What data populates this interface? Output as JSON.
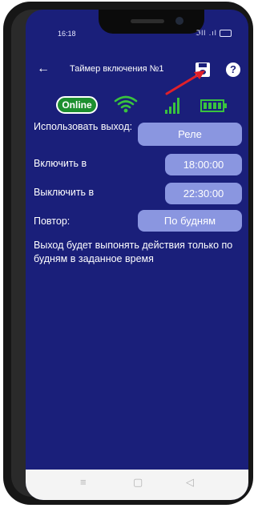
{
  "status_bar": {
    "time": "16:18",
    "icons": "ℑll .ıl"
  },
  "header": {
    "back_icon": "arrow-left-icon",
    "title": "Таймер включения №1",
    "save_icon": "save-icon",
    "help_icon": "help-icon",
    "help_glyph": "?"
  },
  "indicators": {
    "online_label": "Online",
    "online_color": "#1d8f2f",
    "wifi_color": "#39c33e",
    "signal_color": "#39c33e",
    "battery_color": "#39c33e"
  },
  "form": {
    "output_label": "Использовать выход:",
    "output_value": "Реле",
    "on_label": "Включить в",
    "on_value": "18:00:00",
    "off_label": "Выключить в",
    "off_value": "22:30:00",
    "repeat_label": "Повтор:",
    "repeat_value": "По будням"
  },
  "info": "Выход будет выпонять действия только по будням в заданное время",
  "nav": {
    "menu_glyph": "≡",
    "home_glyph": "▢",
    "back_glyph": "◁"
  },
  "colors": {
    "screen_bg": "#1a1f7a",
    "button_bg": "#8a96e0",
    "arrow": "#e0202a"
  }
}
